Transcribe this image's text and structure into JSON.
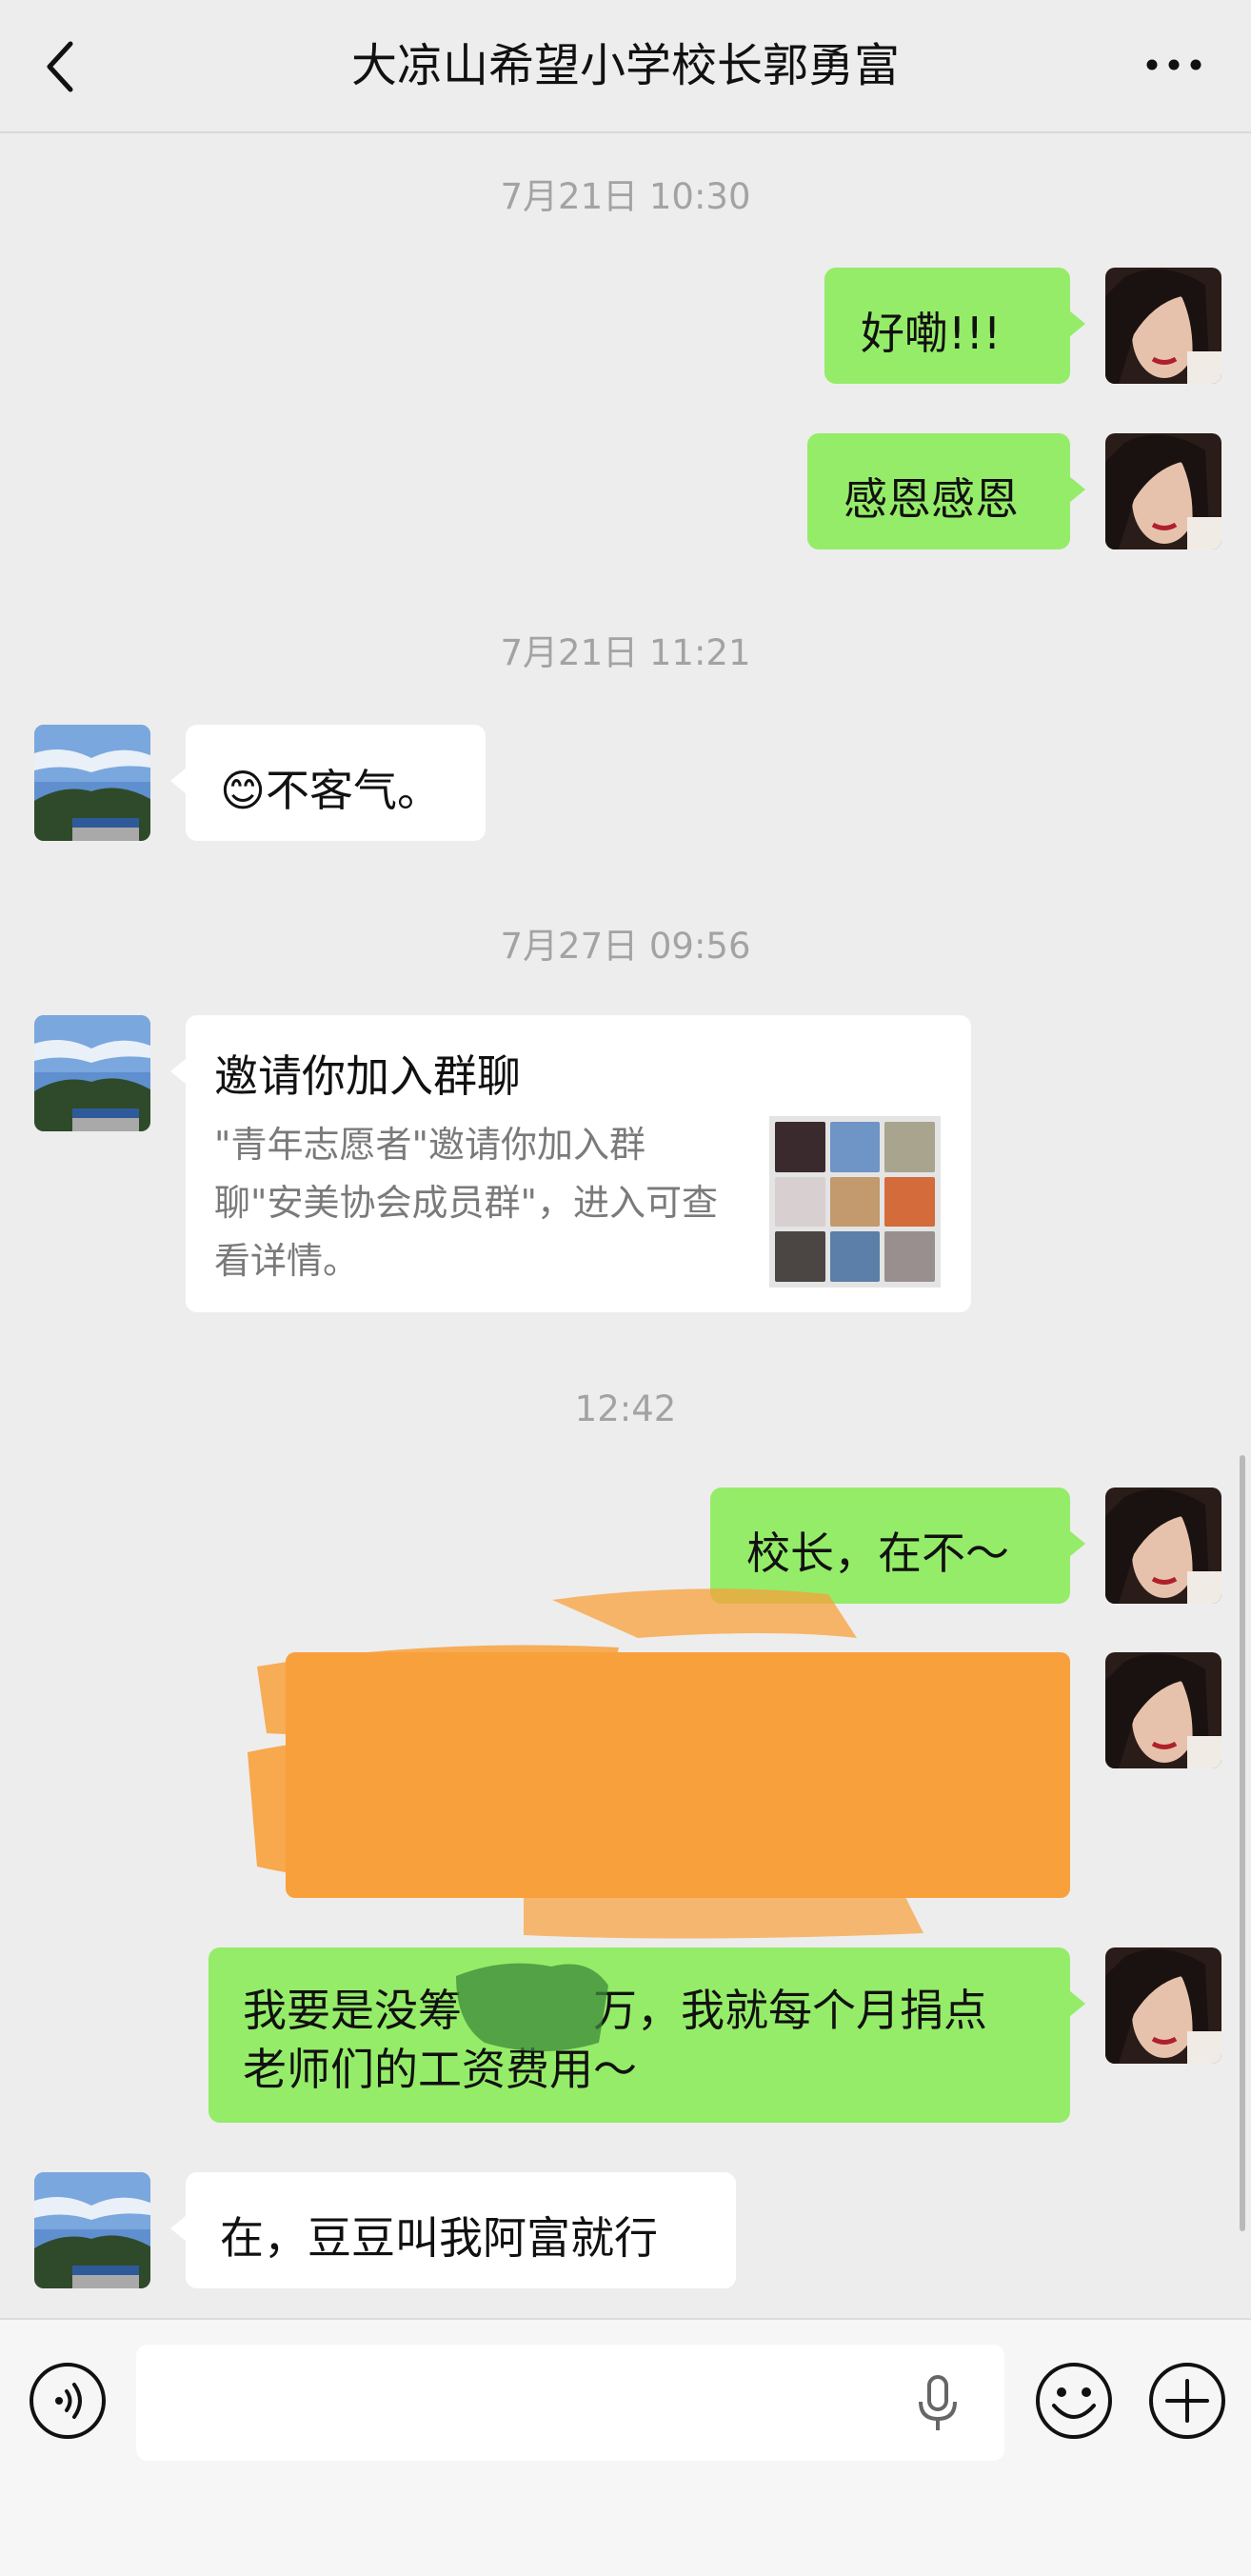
{
  "header": {
    "title": "大凉山希望小学校长郭勇富"
  },
  "messages": {
    "ts1": "7月21日 10:30",
    "m1": "好嘞!!!",
    "m2": "感恩感恩",
    "ts2": "7月21日 11:21",
    "m3_emoji": "😊",
    "m3_text": "不客气。",
    "ts3": "7月27日 09:56",
    "invite": {
      "title": "邀请你加入群聊",
      "desc": "\"青年志愿者\"邀请你加入群聊\"安美协会成员群\"，进入可查看详情。"
    },
    "ts4": "12:42",
    "m5": "校长，在不～",
    "m7_line1": "我要是没筹　　　万，我就每个月捐点",
    "m7_line2": "老师们的工资费用～",
    "m8": "在，豆豆叫我阿富就行"
  },
  "colors": {
    "green_bubble": "#95ec69",
    "white_bubble": "#ffffff",
    "background": "#ededed",
    "redaction": "#f8a03b"
  },
  "icons": {
    "back": "chevron-left-icon",
    "more": "ellipsis-icon",
    "voice": "voice-icon",
    "mic": "microphone-icon",
    "emoji": "emoji-icon",
    "plus": "plus-icon"
  }
}
